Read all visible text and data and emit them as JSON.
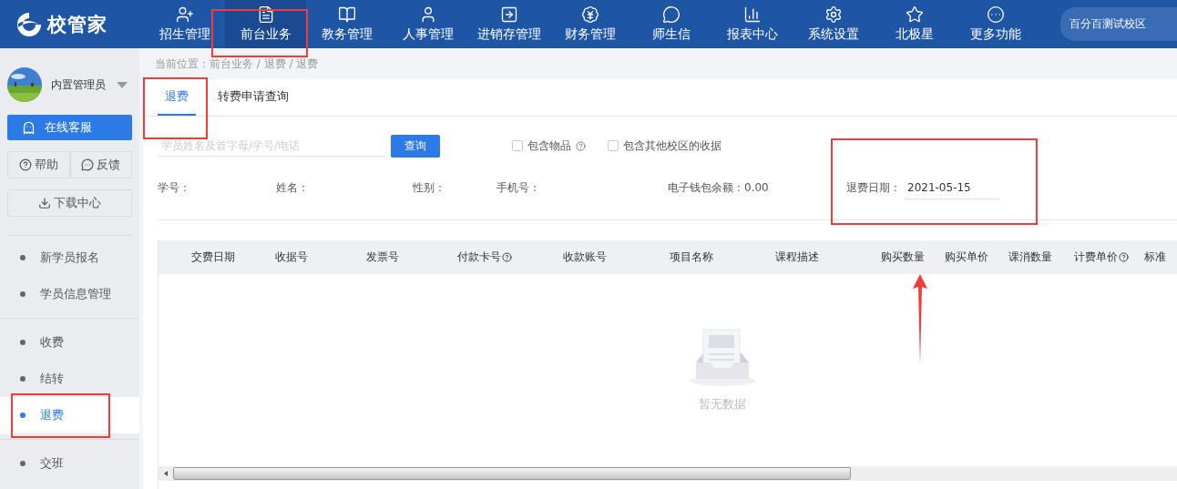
{
  "topbar": {
    "logo": "校管家",
    "nav": [
      {
        "label": "招生管理",
        "selected": false
      },
      {
        "label": "前台业务",
        "selected": true
      },
      {
        "label": "教务管理",
        "selected": false
      },
      {
        "label": "人事管理",
        "selected": false
      },
      {
        "label": "进销存管理",
        "selected": false
      },
      {
        "label": "财务管理",
        "selected": false
      },
      {
        "label": "师生信",
        "selected": false
      },
      {
        "label": "报表中心",
        "selected": false
      },
      {
        "label": "系统设置",
        "selected": false
      },
      {
        "label": "北极星",
        "selected": false
      },
      {
        "label": "更多功能",
        "selected": false
      }
    ],
    "campus": "百分百测试校区"
  },
  "sidebar": {
    "user": "内置管理员",
    "service_button": "在线客服",
    "help_button": "帮助",
    "feedback_button": "反馈",
    "download_button": "下载中心",
    "groups": [
      [
        {
          "label": "新学员报名",
          "selected": false
        },
        {
          "label": "学员信息管理",
          "selected": false
        }
      ],
      [
        {
          "label": "收费",
          "selected": false
        },
        {
          "label": "结转",
          "selected": false
        },
        {
          "label": "退费",
          "selected": true
        }
      ],
      [
        {
          "label": "交班",
          "selected": false
        }
      ]
    ]
  },
  "breadcrumb": "当前位置：前台业务 / 退费 / 退费",
  "tabs": [
    {
      "label": "退费",
      "selected": true
    },
    {
      "label": "转费申请查询",
      "selected": false
    }
  ],
  "search": {
    "placeholder": "学员姓名及首字母/学号/电话",
    "button": "查询"
  },
  "options": [
    {
      "label": "包含物品",
      "checked": false,
      "help": true
    },
    {
      "label": "包含其他校区的收据",
      "checked": false,
      "help": false
    }
  ],
  "info": [
    {
      "label": "学号："
    },
    {
      "label": "姓名："
    },
    {
      "label": "性别："
    },
    {
      "label": "手机号："
    },
    {
      "label": "电子钱包余额：0.00"
    }
  ],
  "refund_date": {
    "label": "退费日期：",
    "value": "2021-05-15"
  },
  "table": {
    "columns": [
      {
        "label": "交费日期",
        "help": false
      },
      {
        "label": "收据号",
        "help": false
      },
      {
        "label": "发票号",
        "help": false
      },
      {
        "label": "付款卡号",
        "help": true
      },
      {
        "label": "收款账号",
        "help": false
      },
      {
        "label": "项目名称",
        "help": false
      },
      {
        "label": "课程描述",
        "help": false
      },
      {
        "label": "购买数量",
        "help": false
      },
      {
        "label": "购买单价",
        "help": false
      },
      {
        "label": "课消数量",
        "help": false
      },
      {
        "label": "计费单价",
        "help": true
      },
      {
        "label": "标准",
        "help": false
      }
    ],
    "empty_text": "暂无数据"
  },
  "markup": [
    {
      "kind": "frame"
    },
    {
      "kind": "frame"
    },
    {
      "kind": "frame"
    },
    {
      "kind": "frame"
    },
    {
      "kind": "arrow"
    }
  ]
}
